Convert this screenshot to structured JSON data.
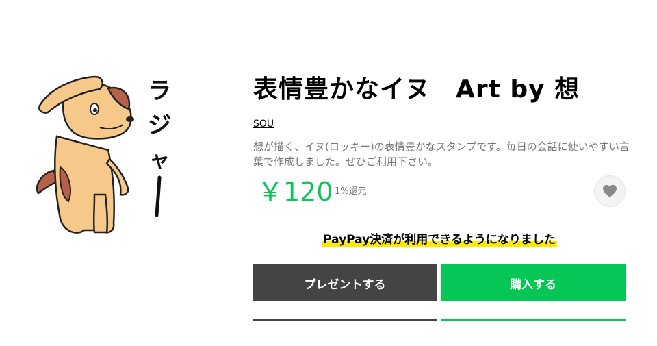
{
  "product": {
    "title": "表情豊かなイヌ　Art by 想",
    "author": "SOU",
    "description": "想が描く、イヌ(ロッキー)の表情豊かなスタンプです。毎日の会話に使いやすい言葉で作成しました。ぜひご利用下さい。",
    "price": "￥120",
    "cashback": "1%還元"
  },
  "sticker": {
    "image_icon": "dog-salute-sticker",
    "text": "ラジャー"
  },
  "favorite": {
    "icon": "heart-icon"
  },
  "notice": {
    "text": "PayPay決済が利用できるようになりました"
  },
  "actions": {
    "gift_label": "プレゼントする",
    "buy_label": "購入する"
  },
  "colors": {
    "accent_green": "#06c755",
    "dark_button": "#444444",
    "highlight_yellow": "#ffeb00"
  }
}
